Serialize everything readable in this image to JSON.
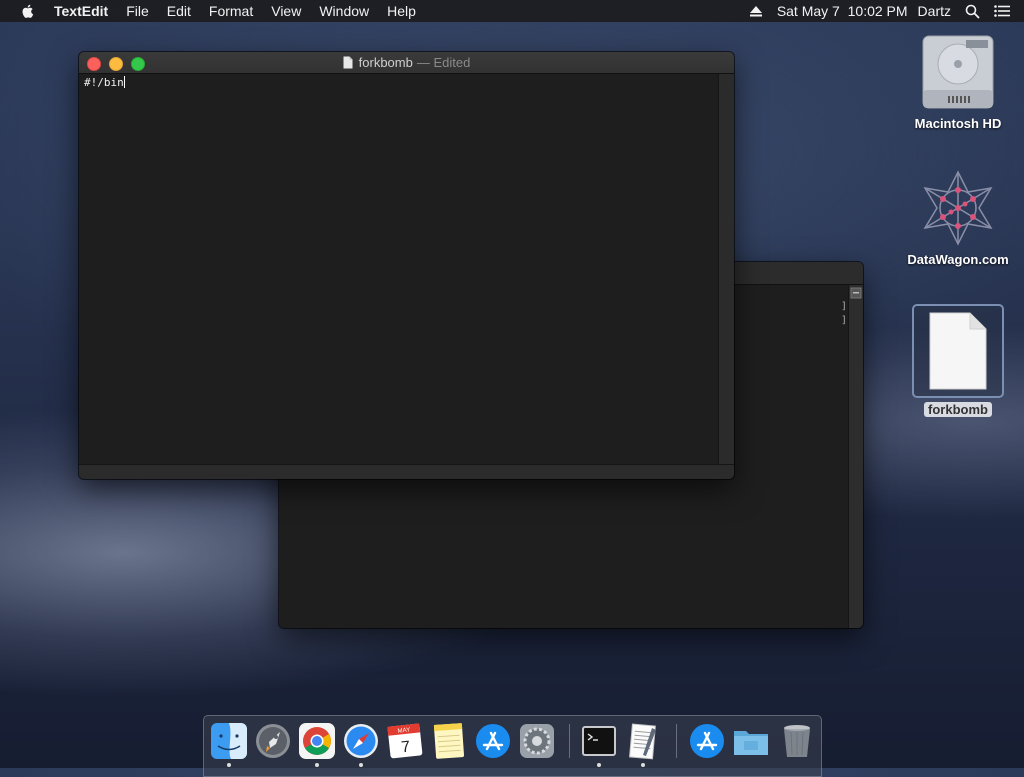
{
  "menubar": {
    "app_name": "TextEdit",
    "items": [
      "File",
      "Edit",
      "Format",
      "View",
      "Window",
      "Help"
    ],
    "clock": "Sat May 7  10:02 PM",
    "user": "Dartz"
  },
  "desktop": {
    "icons": [
      {
        "label": "Macintosh HD",
        "icon": "hard-drive-icon"
      },
      {
        "label": "DataWagon.com",
        "icon": "network-star-icon"
      },
      {
        "label": "forkbomb",
        "icon": "document-icon",
        "selected": true
      }
    ]
  },
  "front_window": {
    "title": "forkbomb",
    "edited": "— Edited",
    "content": "#!/bin"
  },
  "back_window": {
    "brackets": [
      "]",
      "]"
    ]
  },
  "dock": {
    "apps": [
      {
        "name": "finder-icon",
        "running": true
      },
      {
        "name": "launchpad-icon",
        "running": false
      },
      {
        "name": "chrome-icon",
        "running": true
      },
      {
        "name": "safari-icon",
        "running": true
      },
      {
        "name": "calendar-icon",
        "running": false,
        "month": "MAY",
        "day": "7"
      },
      {
        "name": "notes-icon",
        "running": false
      },
      {
        "name": "app-store-icon",
        "running": false
      },
      {
        "name": "system-preferences-icon",
        "running": false
      },
      {
        "name": "terminal-icon",
        "running": true
      },
      {
        "name": "textedit-icon",
        "running": true
      },
      {
        "name": "app-store-downloads-icon",
        "running": false
      },
      {
        "name": "folder-icon",
        "running": false
      },
      {
        "name": "trash-icon",
        "running": false
      }
    ]
  },
  "colors": {
    "close": "#fc605c",
    "minimize": "#fdbc40",
    "maximize": "#34c84a"
  }
}
